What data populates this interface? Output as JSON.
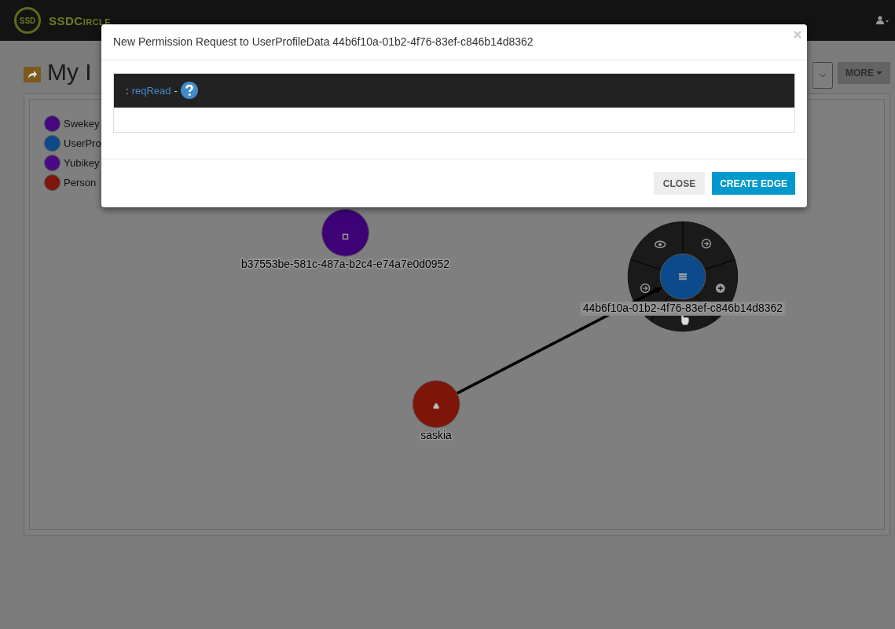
{
  "navbar": {
    "logo_text": "SSD",
    "brand": "SSDCircle"
  },
  "page": {
    "title": "My I",
    "more_button": "MORE"
  },
  "legend": [
    {
      "label": "Swekey",
      "color": "#45097f"
    },
    {
      "label": "UserPro",
      "color": "#0e4a8a"
    },
    {
      "label": "Yubikey",
      "color": "#4a0a85"
    },
    {
      "label": "Person",
      "color": "#7d170b"
    }
  ],
  "graph": {
    "nodes": [
      {
        "label": "b37553be-581c-487a-b2c4-e74a7e0d0952",
        "color": "#3e0277",
        "kind": "device",
        "menu_open": false
      },
      {
        "label": "44b6f10a-01b2-4f76-83ef-c846b14d8362",
        "color": "#0d4a8c",
        "kind": "data",
        "menu_open": true
      },
      {
        "label": "saskia",
        "color": "#7e1509",
        "kind": "person",
        "menu_open": false
      }
    ]
  },
  "modal": {
    "title": "New Permission Request to UserProfileData 44b6f10a-01b2-4f76-83ef-c846b14d8362",
    "prefix": ":",
    "permission": "reqRead",
    "separator": "-",
    "buttons": [
      {
        "label": "CLOSE",
        "kind": "default"
      },
      {
        "label": "CREATE EDGE",
        "kind": "primary"
      }
    ]
  }
}
